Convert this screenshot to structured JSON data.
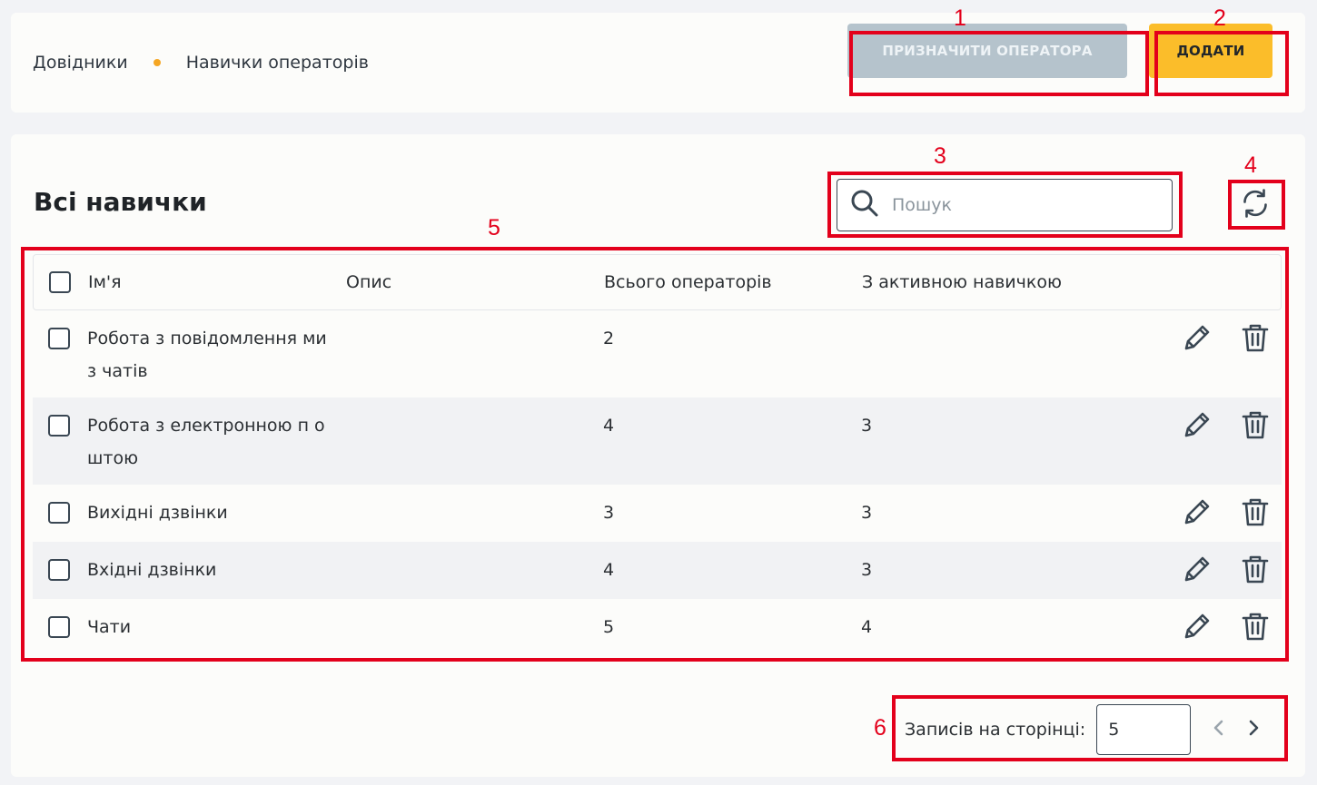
{
  "breadcrumb": {
    "root": "Довідники",
    "current": "Навички операторів"
  },
  "header": {
    "assign_label": "ПРИЗНАЧИТИ ОПЕРАТОРА",
    "add_label": "ДОДАТИ"
  },
  "main": {
    "title": "Всі навички",
    "search": {
      "placeholder": "Пошук",
      "value": ""
    },
    "columns": {
      "name": "Ім'я",
      "description": "Опис",
      "total": "Всього операторів",
      "active": "З активною навичкою"
    },
    "rows": [
      {
        "name": "Робота з повідомлення ми з чатів",
        "description": "",
        "total": "2",
        "active": ""
      },
      {
        "name": "Робота з електронною п оштою",
        "description": "",
        "total": "4",
        "active": "3"
      },
      {
        "name": "Вихідні дзвінки",
        "description": "",
        "total": "3",
        "active": "3"
      },
      {
        "name": "Вхідні дзвінки",
        "description": "",
        "total": "4",
        "active": "3"
      },
      {
        "name": "Чати",
        "description": "",
        "total": "5",
        "active": "4"
      }
    ]
  },
  "pagination": {
    "label": "Записів на сторінці:",
    "per_page": "5"
  },
  "annotations": [
    "1",
    "2",
    "3",
    "4",
    "5",
    "6"
  ],
  "colors": {
    "accent": "#fbbd2a",
    "disabled": "#b5c3cc",
    "annotation": "#e3001b",
    "icon": "#3a4753",
    "dot": "#f5a623"
  },
  "icons": {
    "search": "search-icon",
    "refresh": "refresh-icon",
    "edit": "pencil-icon",
    "delete": "trash-icon",
    "prev": "chevron-left-icon",
    "next": "chevron-right-icon"
  }
}
